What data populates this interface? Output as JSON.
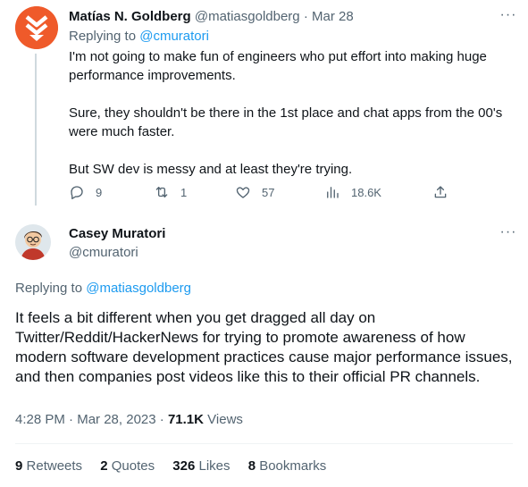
{
  "reply_tweet": {
    "author_name": "Matías N. Goldberg",
    "author_handle": "@matiasgoldberg",
    "separator": "·",
    "date": "Mar 28",
    "replying_prefix": "Replying to",
    "replying_to": "@cmuratori",
    "paragraphs": [
      "I'm not going to make fun of engineers who put effort into making huge performance improvements.",
      "Sure, they shouldn't be there in the 1st place and chat apps from the 00's were much faster.",
      "But SW dev is messy and at least they're trying."
    ],
    "actions": {
      "replies": "9",
      "retweets": "1",
      "likes": "57",
      "views": "18.6K"
    },
    "avatar_color": "#ef5a2a"
  },
  "main_tweet": {
    "author_name": "Casey Muratori",
    "author_handle": "@cmuratori",
    "replying_prefix": "Replying to",
    "replying_to": "@matiasgoldberg",
    "text": "It feels a bit different when you get dragged all day on Twitter/Reddit/HackerNews for trying to promote awareness of how modern software development practices cause major performance issues, and then companies post videos like this to their official PR channels.",
    "time": "4:28 PM",
    "separator": "·",
    "date": "Mar 28, 2023",
    "views_count": "71.1K",
    "views_label": "Views",
    "stats": {
      "retweets_count": "9",
      "retweets_label": "Retweets",
      "quotes_count": "2",
      "quotes_label": "Quotes",
      "likes_count": "326",
      "likes_label": "Likes",
      "bookmarks_count": "8",
      "bookmarks_label": "Bookmarks"
    }
  },
  "colors": {
    "link": "#1d9bf0",
    "muted": "#536471",
    "text": "#0f1419"
  },
  "icons": [
    "reply-icon",
    "retweet-icon",
    "like-icon",
    "views-icon",
    "share-icon",
    "more-icon"
  ]
}
